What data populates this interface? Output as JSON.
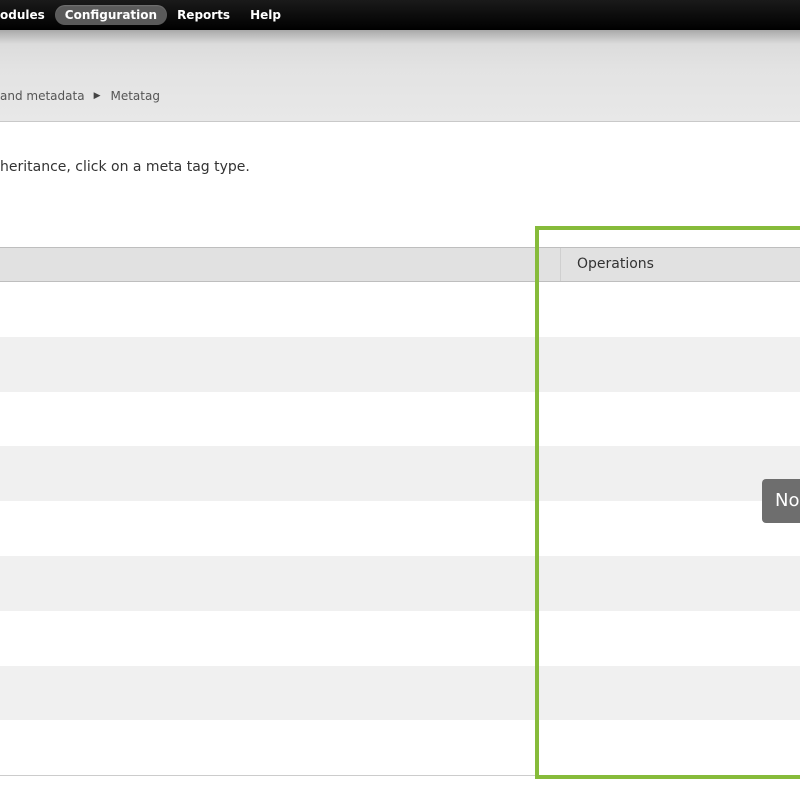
{
  "toolbar": {
    "items": [
      {
        "label": "odules"
      },
      {
        "label": "Configuration"
      },
      {
        "label": "Reports"
      },
      {
        "label": "Help"
      }
    ]
  },
  "breadcrumb": {
    "items": [
      "and metadata",
      "Metatag"
    ],
    "separator": "▶"
  },
  "help_text": "heritance, click on a meta tag type.",
  "table": {
    "columns": [
      "Operations"
    ],
    "row_count": 9
  },
  "tooltip": {
    "text": "No"
  },
  "colors": {
    "highlight": "#86bb3a",
    "toolbar_bg": "#000000",
    "active_tab": "#5a5a5a"
  }
}
